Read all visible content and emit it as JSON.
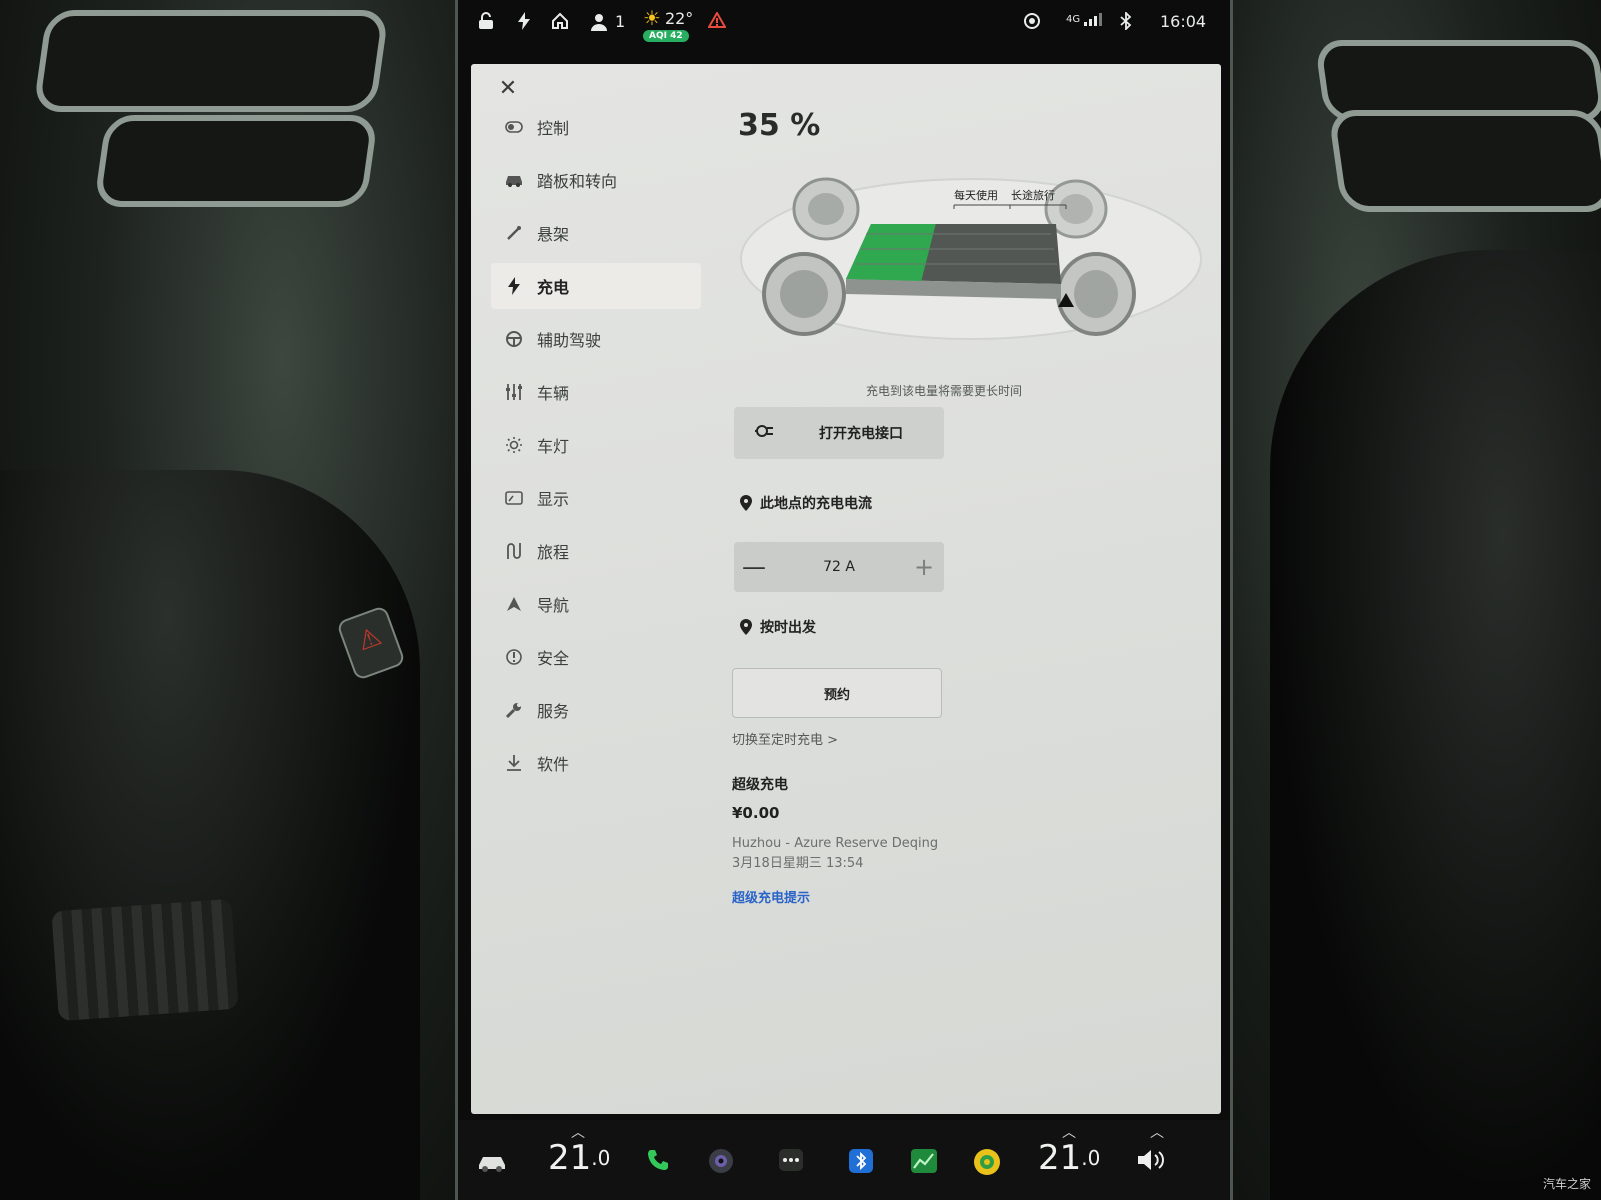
{
  "status_bar": {
    "driver_count": "1",
    "temperature": "22°",
    "aqi": "AQI 42",
    "network": "4G",
    "time": "16:04"
  },
  "settings": {
    "menu": [
      {
        "label": "控制",
        "icon": "toggle-icon"
      },
      {
        "label": "踏板和转向",
        "icon": "car-icon"
      },
      {
        "label": "悬架",
        "icon": "suspension-icon"
      },
      {
        "label": "充电",
        "icon": "bolt-icon",
        "active": true
      },
      {
        "label": "辅助驾驶",
        "icon": "steering-wheel-icon"
      },
      {
        "label": "车辆",
        "icon": "sliders-icon"
      },
      {
        "label": "车灯",
        "icon": "light-icon"
      },
      {
        "label": "显示",
        "icon": "display-icon"
      },
      {
        "label": "旅程",
        "icon": "trip-icon"
      },
      {
        "label": "导航",
        "icon": "navigation-icon"
      },
      {
        "label": "安全",
        "icon": "safety-icon"
      },
      {
        "label": "服务",
        "icon": "wrench-icon"
      },
      {
        "label": "软件",
        "icon": "download-icon"
      }
    ]
  },
  "charging": {
    "battery_percent": "35 %",
    "battery_level": 0.35,
    "charge_limit_label_daily": "每天使用",
    "charge_limit_label_trip": "长途旅行",
    "charge_limit_note": "充电到该电量将需要更长时间",
    "open_port_label": "打开充电接口",
    "current_label": "此地点的充电电流",
    "current_value": "72 A",
    "scheduled_departure_label": "按时出发",
    "schedule_button": "预约",
    "switch_link": "切换至定时充电 >",
    "supercharging_title": "超级充电",
    "supercharging_amount": "¥0.00",
    "supercharging_location": "Huzhou - Azure Reserve Deqing",
    "supercharging_time": "3月18日星期三 13:54",
    "supercharging_tips": "超级充电提示"
  },
  "dock": {
    "driver_temp": "21",
    "driver_temp_decimal": ".0",
    "passenger_temp": "21",
    "passenger_temp_decimal": ".0"
  },
  "watermark": "汽车之家",
  "colors": {
    "battery_green": "#2fa84f",
    "link_blue": "#2a64c8",
    "aqi_green": "#27ae60",
    "alert_red": "#e74c3c"
  }
}
